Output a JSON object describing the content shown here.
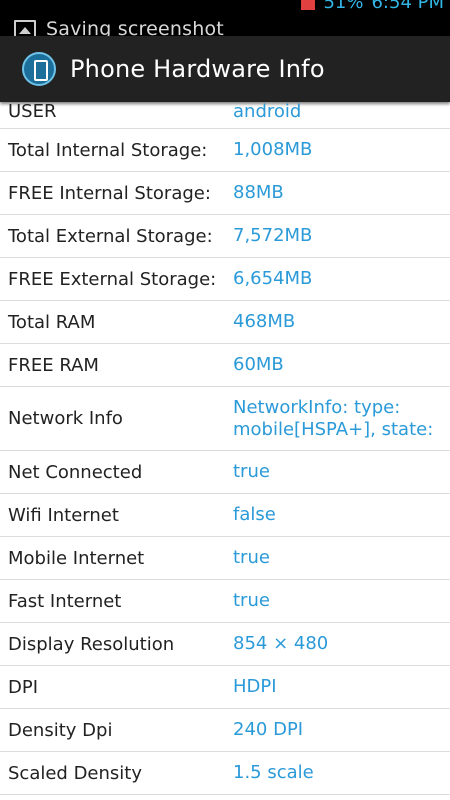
{
  "status_bar": {
    "ticker_text": "Saving screenshot",
    "battery": "51%",
    "time": "6:54 PM"
  },
  "action_bar": {
    "title": "Phone Hardware Info"
  },
  "rows": [
    {
      "label": "USER",
      "value": "android"
    },
    {
      "label": "Total Internal Storage:",
      "value": "1,008MB"
    },
    {
      "label": "FREE Internal Storage:",
      "value": "88MB"
    },
    {
      "label": "Total External Storage:",
      "value": "7,572MB"
    },
    {
      "label": "FREE External Storage:",
      "value": "6,654MB"
    },
    {
      "label": "Total RAM",
      "value": "468MB"
    },
    {
      "label": "FREE RAM",
      "value": "60MB"
    },
    {
      "label": "Network Info",
      "value_line1": "NetworkInfo: type:",
      "value_line2": "mobile[HSPA+], state:"
    },
    {
      "label": "Net Connected",
      "value": "true"
    },
    {
      "label": "Wifi Internet",
      "value": "false"
    },
    {
      "label": "Mobile Internet",
      "value": "true"
    },
    {
      "label": "Fast Internet",
      "value": "true"
    },
    {
      "label": "Display Resolution",
      "value": "854 × 480"
    },
    {
      "label": "DPI",
      "value": "HDPI"
    },
    {
      "label": "Density Dpi",
      "value": "240 DPI"
    },
    {
      "label": "Scaled Density",
      "value": "1.5 scale"
    }
  ],
  "colors": {
    "value_text": "#2b9ad8",
    "action_bar": "#222222",
    "divider": "#dcdcdc"
  }
}
